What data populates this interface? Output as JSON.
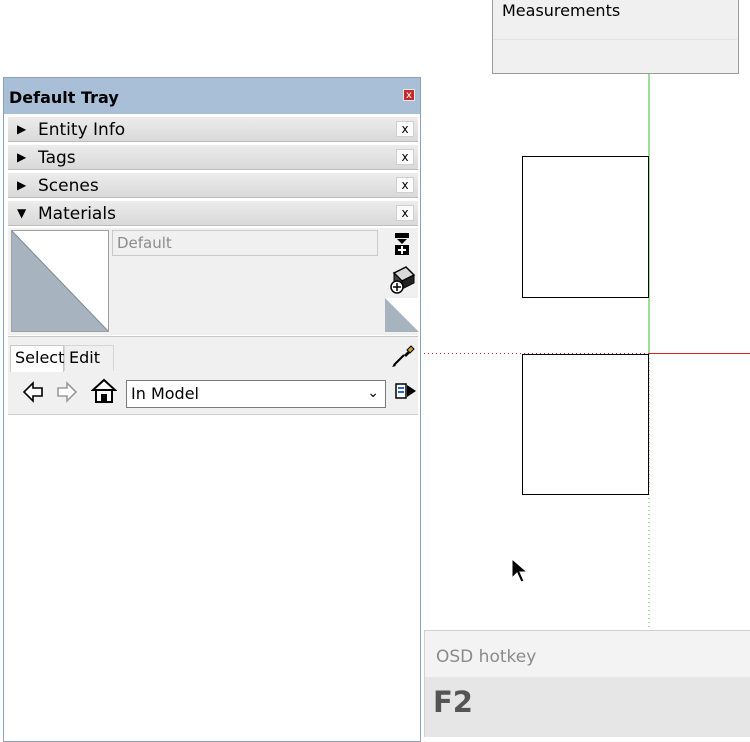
{
  "measurements": {
    "label": "Measurements"
  },
  "tray": {
    "title": "Default Tray",
    "close_glyph": "x",
    "panels": [
      {
        "label": "Entity Info",
        "expanded": false,
        "close_glyph": "x"
      },
      {
        "label": "Tags",
        "expanded": false,
        "close_glyph": "x"
      },
      {
        "label": "Scenes",
        "expanded": false,
        "close_glyph": "x"
      },
      {
        "label": "Materials",
        "expanded": true,
        "close_glyph": "x"
      }
    ],
    "materials": {
      "name_value": "Default",
      "tabs": [
        "Select",
        "Edit"
      ],
      "active_tab": "Select",
      "collection_value": "In Model",
      "icons": [
        "create-material-icon",
        "paint-bucket-icon",
        "default-material-icon",
        "eyedropper-icon",
        "back-arrow-icon",
        "forward-arrow-icon",
        "home-icon",
        "details-menu-icon"
      ]
    }
  },
  "viewport": {
    "axis_colors": {
      "green": "#35c235",
      "red": "#d42020"
    },
    "cursor": "arrow-cursor"
  },
  "osd": {
    "label": "OSD hotkey",
    "key": "F2"
  }
}
